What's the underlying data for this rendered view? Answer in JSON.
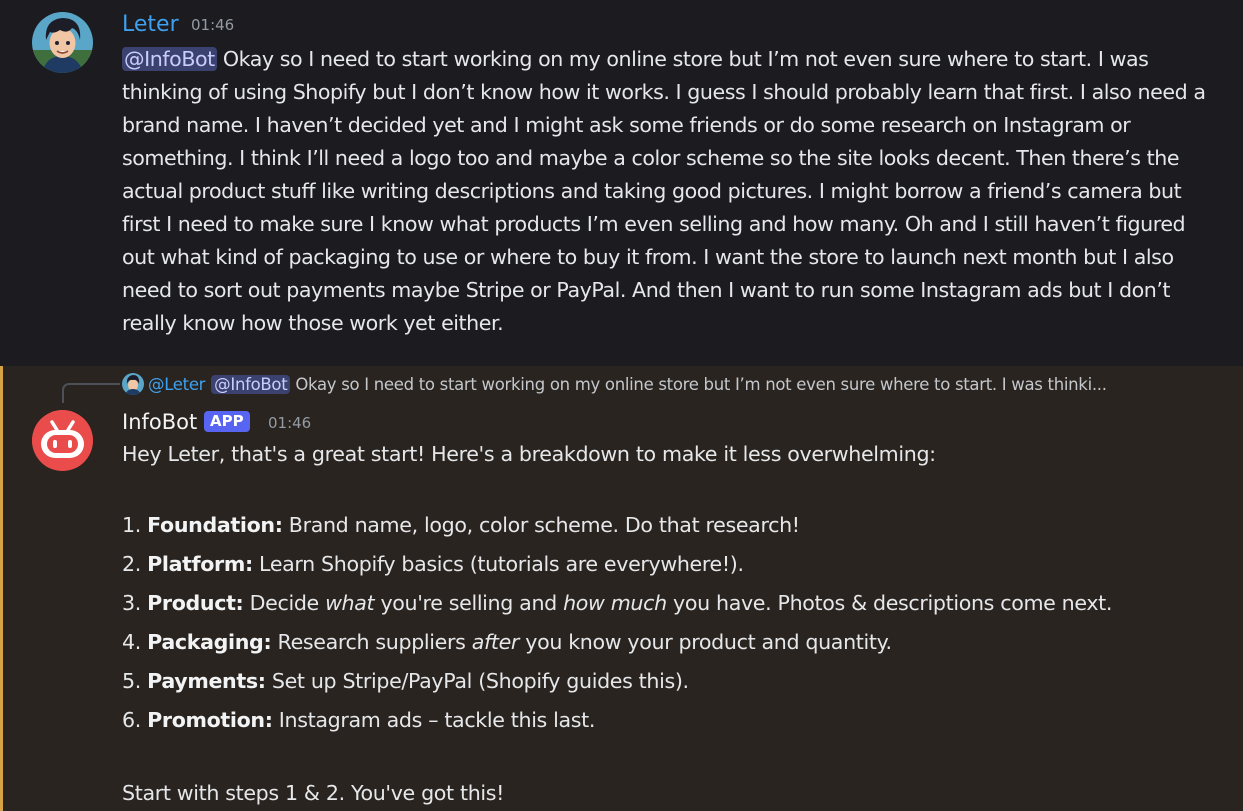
{
  "message1": {
    "author": "Leter",
    "time": "01:46",
    "mention": "@InfoBot",
    "text": " Okay so I need to start working on my online store but I’m not even sure where to start. I was thinking of using Shopify but I don’t know how it works. I guess I should probably learn that first. I also need a brand name. I haven’t decided yet and I might ask some friends or do some research on Instagram or something. I think I’ll need a logo too and maybe a color scheme so the site looks decent. Then there’s the actual product stuff like writing descriptions and taking good pictures. I might borrow a friend’s camera but first I need to make sure I know what products I’m even selling and how many. Oh and I still haven’t figured out what kind of packaging to use or where to buy it from. I want the store to launch next month but I also need to sort out payments maybe Stripe or PayPal. And then I want to run some Instagram ads but I don’t really know how those work yet either."
  },
  "reply": {
    "author": "@Leter",
    "mention": "@InfoBot",
    "snippet": "Okay so I need to start working on my online store but I’m not even sure where to start. I was thinki..."
  },
  "message2": {
    "author": "InfoBot",
    "badge": "APP",
    "time": "01:46",
    "intro": "Hey Leter, that's a great start! Here's a breakdown to make it less overwhelming:",
    "steps": [
      {
        "num": "1. ",
        "title": "Foundation:",
        "text": " Brand name, logo, color scheme. Do that research!"
      },
      {
        "num": "2. ",
        "title": "Platform:",
        "text": " Learn Shopify basics (tutorials are everywhere!)."
      },
      {
        "num": "3. ",
        "title": "Product:",
        "pre": " Decide ",
        "em1": "what",
        "mid": " you're selling and ",
        "em2": "how much",
        "post": " you have. Photos & descriptions come next."
      },
      {
        "num": "4. ",
        "title": "Packaging:",
        "pre": " Research suppliers ",
        "em1": "after",
        "post": " you know your product and quantity."
      },
      {
        "num": "5. ",
        "title": "Payments:",
        "text": " Set up Stripe/PayPal (Shopify guides this)."
      },
      {
        "num": "6. ",
        "title": "Promotion:",
        "text": " Instagram ads – tackle this last."
      }
    ],
    "outro": "Start with steps 1 & 2. You've got this!"
  },
  "colors": {
    "background": "#1b1b20",
    "highlight_background": "#29241f",
    "highlight_bar": "#d6a445",
    "username_blue": "#3ea0ef",
    "mention_bg": "#3c4270",
    "app_badge": "#5865f2",
    "bot_avatar": "#ea4c4c"
  }
}
